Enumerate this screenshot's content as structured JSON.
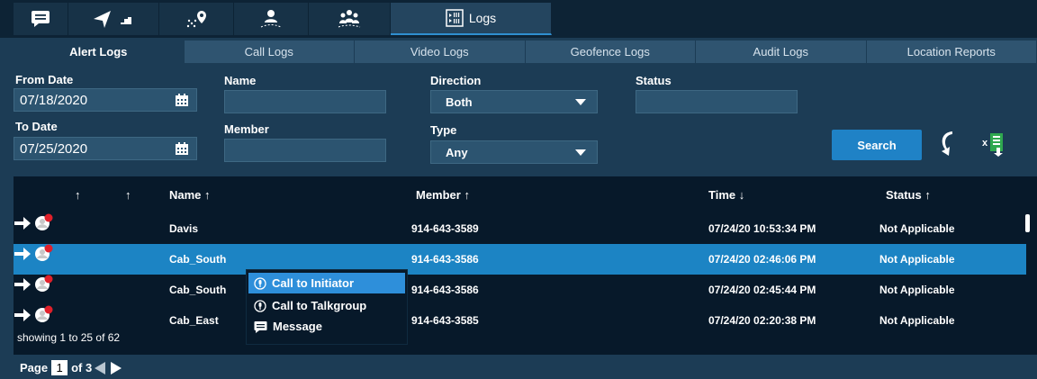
{
  "topbar": {
    "tabs": [
      {
        "icon": "chat-icon"
      },
      {
        "icon": "navigation-icon"
      },
      {
        "icon": "geofence-icon"
      },
      {
        "icon": "member-location-icon"
      },
      {
        "icon": "group-icon"
      },
      {
        "icon": "logs-icon",
        "label": "Logs"
      }
    ]
  },
  "subtabs": [
    "Alert Logs",
    "Call Logs",
    "Video Logs",
    "Geofence Logs",
    "Audit Logs",
    "Location Reports"
  ],
  "filters": {
    "from_date_label": "From Date",
    "from_date_value": "07/18/2020",
    "to_date_label": "To Date",
    "to_date_value": "07/25/2020",
    "name_label": "Name",
    "name_value": "",
    "member_label": "Member",
    "member_value": "",
    "direction_label": "Direction",
    "direction_value": "Both",
    "type_label": "Type",
    "type_value": "Any",
    "status_label": "Status",
    "status_value": "",
    "search_label": "Search"
  },
  "table": {
    "headers": {
      "col1": "↑",
      "col2": "↑",
      "name": "Name ↑",
      "member": "Member ↑",
      "time": "Time ↓",
      "status": "Status ↑"
    },
    "rows": [
      {
        "name": "Davis",
        "member": "914-643-3589",
        "time": "07/24/20 10:53:34 PM",
        "status": "Not Applicable"
      },
      {
        "name": "Cab_South",
        "member": "914-643-3586",
        "time": "07/24/20 02:46:06 PM",
        "status": "Not Applicable"
      },
      {
        "name": "Cab_South",
        "member": "914-643-3586",
        "time": "07/24/20 02:45:44 PM",
        "status": "Not Applicable"
      },
      {
        "name": "Cab_East",
        "member": "914-643-3585",
        "time": "07/24/20 02:20:38 PM",
        "status": "Not Applicable"
      }
    ],
    "showing": "showing 1 to 25 of 62"
  },
  "context_menu": {
    "items": [
      "Call to Initiator",
      "Call to Talkgroup",
      "Message"
    ]
  },
  "pager": {
    "page_label": "Page",
    "current_page": "1",
    "of_label": "of 3"
  },
  "colors": {
    "background": "#1c3c55",
    "accent": "#1f82c6",
    "selected_row": "#1c84c4",
    "alert_dot": "#e0202a"
  }
}
